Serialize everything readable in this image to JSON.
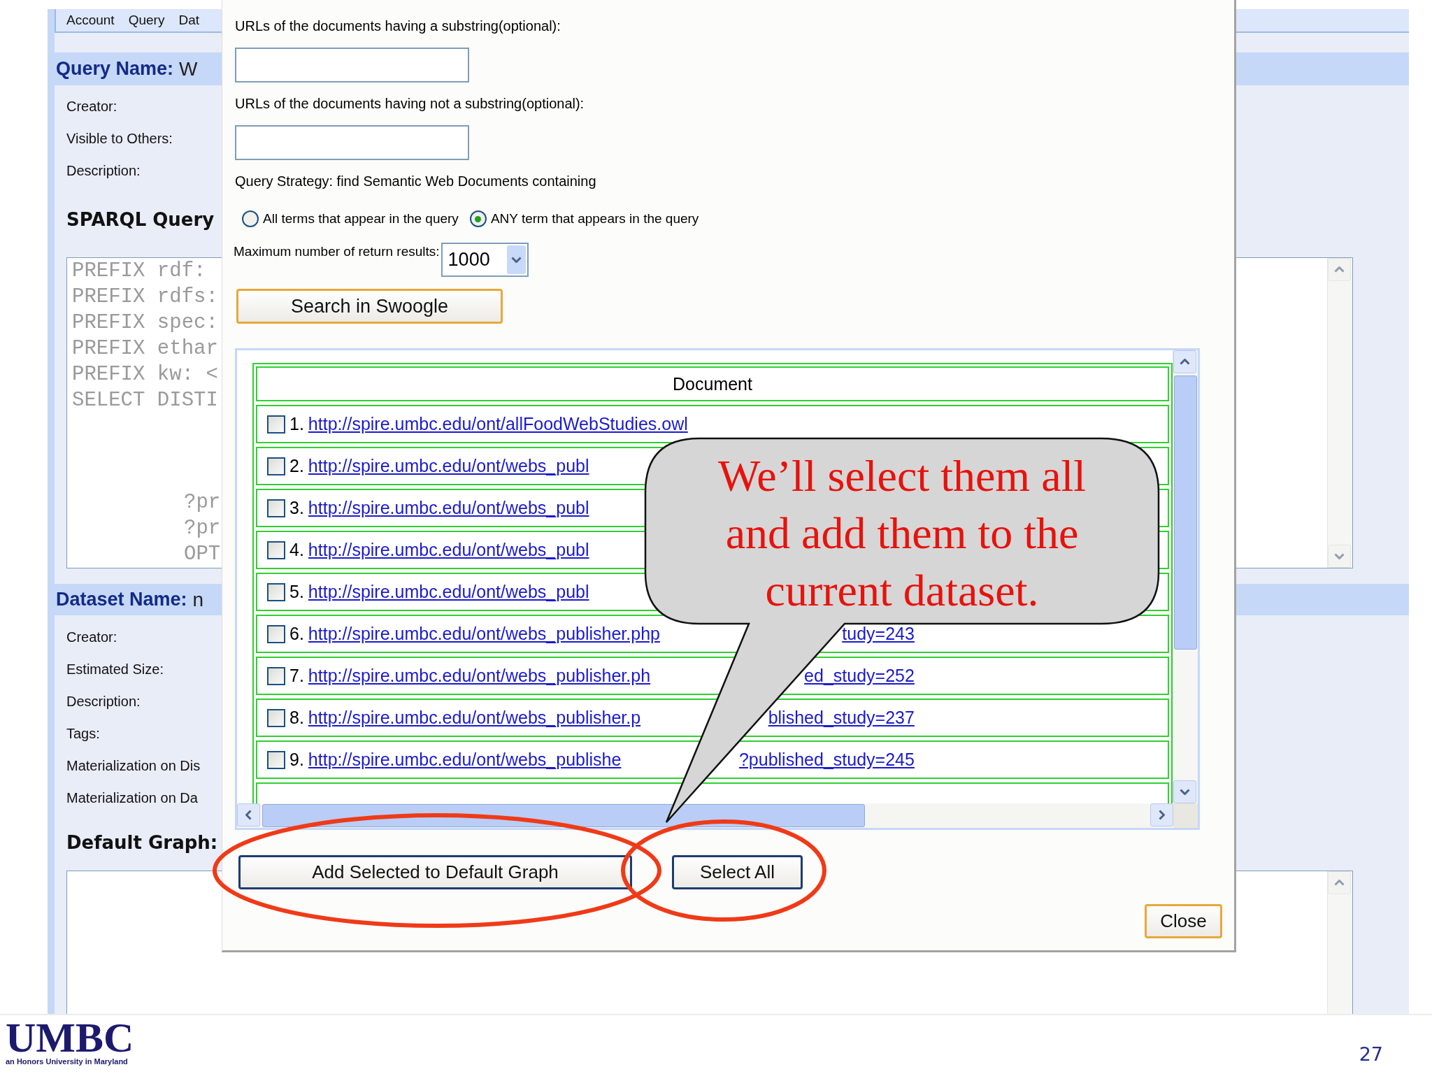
{
  "background_app": {
    "menu": [
      {
        "label": "Account"
      },
      {
        "label": "Query"
      },
      {
        "label": "Dat"
      }
    ],
    "query_section": {
      "label": "Query Name:",
      "value": "W",
      "fields": [
        "Creator:",
        "Visible to Others:",
        "Description:"
      ]
    },
    "sparql": {
      "heading": "SPARQL Query",
      "code_head": [
        "PREFIX rdf:",
        "PREFIX rdfs:",
        "PREFIX spec:",
        "PREFIX ethar",
        "PREFIX kw: <",
        "SELECT DISTI"
      ],
      "code_tail": [
        "?pr",
        "?pr",
        "OPT"
      ]
    },
    "dataset_section": {
      "label": "Dataset Name:",
      "value": "n",
      "fields": [
        "Creator:",
        "Estimated Size:",
        "Description:",
        "Tags:",
        "Materialization on Dis",
        "Materialization on Da"
      ]
    },
    "default_graph": {
      "heading": "Default Graph:"
    }
  },
  "dialog": {
    "include_label": "URLs of the documents having a substring(optional):",
    "exclude_label": "URLs of the documents having not a substring(optional):",
    "strategy_label": "Query Strategy: find Semantic Web Documents containing",
    "strategy_options": [
      {
        "label": "All terms that appear in the query",
        "selected": false
      },
      {
        "label": "ANY term that appears in the query",
        "selected": true
      }
    ],
    "max_results_label": "Maximum number of return results:",
    "max_results_value": "1000",
    "search_button": "Search in Swoogle",
    "results": {
      "column": "Document",
      "rows": [
        {
          "number": "1.",
          "link": "http://spire.umbc.edu/ont/allFoodWebStudies.owl",
          "checked": false
        },
        {
          "number": "2.",
          "link": "http://spire.umbc.edu/ont/webs_publ",
          "checked": false
        },
        {
          "number": "3.",
          "link": "http://spire.umbc.edu/ont/webs_publ",
          "checked": false
        },
        {
          "number": "4.",
          "link": "http://spire.umbc.edu/ont/webs_publ",
          "checked": false
        },
        {
          "number": "5.",
          "link": "http://spire.umbc.edu/ont/webs_publ",
          "checked": false
        },
        {
          "number": "6.",
          "link": "http://spire.umbc.edu/ont/webs_publisher.php",
          "link_end": "tudy=243",
          "checked": false
        },
        {
          "number": "7.",
          "link": "http://spire.umbc.edu/ont/webs_publisher.ph",
          "link_end": "ed_study=252",
          "checked": false
        },
        {
          "number": "8.",
          "link": "http://spire.umbc.edu/ont/webs_publisher.p",
          "link_end": "blished_study=237",
          "checked": false
        },
        {
          "number": "9.",
          "link": "http://spire.umbc.edu/ont/webs_publishe",
          "link_end": "?published_study=245",
          "checked": false
        }
      ]
    },
    "add_button": "Add Selected to Default Graph",
    "select_all_button": "Select All",
    "close_button": "Close"
  },
  "callout": {
    "text": "We’ll select them all and add them to the current dataset."
  },
  "slide": {
    "logo": "UMBC",
    "logo_tagline": "an Honors University in Maryland",
    "page_number": "27"
  }
}
